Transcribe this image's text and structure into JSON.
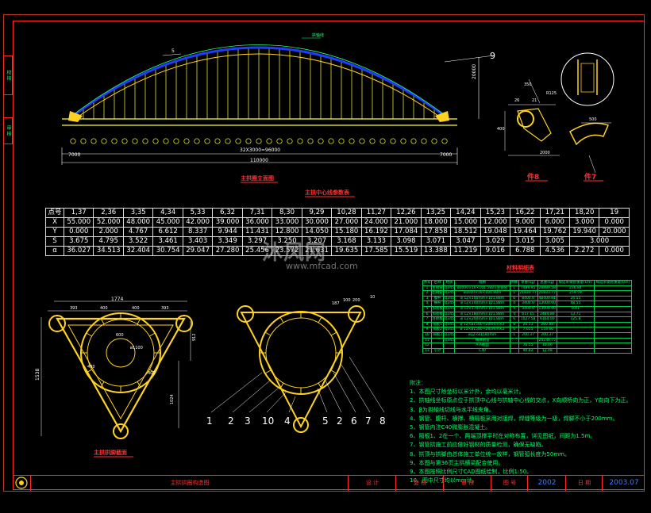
{
  "sidebar": {
    "tab1": "校 核",
    "tab2": "审 核"
  },
  "elevation": {
    "title": "主拱圈立面图",
    "arch_label": "拱轴线",
    "callout": "9",
    "dims": {
      "span": "110000",
      "segments": "32X3000=96000",
      "left": "7000",
      "right": "7000",
      "rise": "20000",
      "top": "5"
    }
  },
  "detail8": {
    "title": "件8",
    "dims": [
      "350",
      "8",
      "26",
      "8",
      "21",
      "150",
      "400",
      "R125",
      "480",
      "2000"
    ]
  },
  "detail7": {
    "title": "件7",
    "dims": [
      "500",
      "R100"
    ]
  },
  "param_table": {
    "title": "主拱中心线参数表",
    "rows": [
      {
        "h": "点号",
        "c": [
          "1,37",
          "2,36",
          "3,35",
          "4,34",
          "5,33",
          "6,32",
          "7,31",
          "8,30",
          "9,29",
          "10,28",
          "11,27",
          "12,26",
          "13,25",
          "14,24",
          "15,23",
          "16,22",
          "17,21",
          "18,20",
          "19"
        ]
      },
      {
        "h": "X",
        "c": [
          "55.000",
          "52.000",
          "48.000",
          "45.000",
          "42.000",
          "39.000",
          "36.000",
          "33.000",
          "30.000",
          "27.000",
          "24.000",
          "21.000",
          "18.000",
          "15.000",
          "12.000",
          "9.000",
          "6.000",
          "3.000",
          "0.000"
        ]
      },
      {
        "h": "Y",
        "c": [
          "0.000",
          "2.000",
          "4.767",
          "6.612",
          "8.337",
          "9.944",
          "11.431",
          "12.800",
          "14.050",
          "15.180",
          "16.192",
          "17.084",
          "17.858",
          "18.512",
          "19.048",
          "19.464",
          "19.762",
          "19.940",
          "20.000"
        ]
      },
      {
        "h": "S",
        "c": [
          "3.675",
          "4.795",
          "3.522",
          "3.461",
          "3.403",
          "3.349",
          "3.297",
          "3.250",
          "3.207",
          "3.168",
          "3.133",
          "3.098",
          "3.071",
          "3.047",
          "3.029",
          "3.015",
          "3.005",
          "3.000"
        ]
      },
      {
        "h": "α",
        "c": [
          "36.027",
          "34.513",
          "32.404",
          "30.754",
          "29.047",
          "27.280",
          "25.456",
          "23.572",
          "21.631",
          "19.635",
          "17.585",
          "15.519",
          "13.388",
          "11.219",
          "9.016",
          "6.788",
          "4.536",
          "2.272",
          "0.000"
        ]
      }
    ]
  },
  "section_a": {
    "title": "主拱拱脚截面",
    "dims": {
      "w": "1774",
      "a": "393",
      "b": "400",
      "c": "400",
      "d": "393",
      "h": "1538",
      "r1": "912",
      "r2": "1024",
      "d1": "600",
      "d2": "620",
      "rr": "ø1100",
      "s1": "400",
      "s2": "400"
    }
  },
  "section_b": {
    "dims": [
      "187",
      "100",
      "200",
      "50",
      "10"
    ],
    "callouts": [
      "1",
      "2",
      "3",
      "10",
      "4",
      "5",
      "2",
      "6",
      "7",
      "8"
    ]
  },
  "material": {
    "title": "材料明细表",
    "headers": [
      "件号",
      "名称",
      "材质",
      "规格",
      "件数",
      "单重(kg)",
      "总重(kg)",
      "每延米钢管重量(t/m)",
      "每延米钢管重量(t/m)"
    ],
    "rows": [
      [
        "1",
        "主钢管",
        "Q345",
        "ø1000×16×101.588×主钢管",
        "1",
        "7486.95",
        "28889.58"
      ],
      [
        "2",
        "副钢管",
        "Q345",
        "ø1100×16×101.88m",
        "1",
        "21833.77",
        "21833.77"
      ],
      [
        "3",
        "腹杆",
        "Q345",
        "ø 12×100mm×101.88m",
        "6",
        "8400.0",
        "48400.81"
      ],
      [
        "4",
        "横杆",
        "Q345",
        "ø 12×100mm×101.88m",
        "4",
        "3400.0",
        "13000.00"
      ],
      [
        "5",
        "加劲板",
        "Q345",
        "ø 12×174mm×101.88m",
        "4",
        "3400.0",
        "13000.00"
      ],
      [
        "6",
        "加劲板",
        "Q345",
        "ø 12×180mm×101.88m",
        "4",
        "617.15",
        "2484.86"
      ],
      [
        "7",
        "连接板",
        "Q345",
        "ø 12×200mm×101.88m",
        "6",
        "1027.58",
        "6164.00"
      ],
      [
        "8",
        "隔板1",
        "Q345",
        "ø 12×ø1580~280mm×2",
        "8",
        "25.11",
        "200.88"
      ],
      [
        "9",
        "隔板2",
        "Q345",
        "ø 12×ø1580~280mm×2",
        "6",
        "7.655",
        "153.60"
      ],
      [
        "10",
        "隔板3",
        "Q345",
        "ø12×ø1580mm",
        "1",
        "200.37",
        "200.37"
      ],
      [
        "11",
        "",
        "Q345",
        "横撑钢管",
        "",
        "",
        "24236.75"
      ],
      [
        "12",
        "",
        "",
        "A-A截面",
        "",
        "76.55",
        "10.06"
      ],
      [
        "13",
        "小计",
        "",
        "C40",
        "",
        "90.82",
        "12.48"
      ]
    ],
    "sums": [
      "236.84",
      "259.59",
      "24.55",
      "48.55",
      "0.01",
      "13.71",
      "125.8"
    ]
  },
  "notes": {
    "head": "附注：",
    "items": [
      "1、本图尺寸除坐标以米计外，余均以毫米计。",
      "2、拱轴线坐标原点位于拱顶中心线与拱轴中心线的交点，X向顺桥向为正，Y向向下为正。",
      "3、β为拱轴线切线与水平线夹角。",
      "4、钢管、腹杆、横撑、横隔板采用对接焊，焊缝等级为一级，焊脚不小于200mm。",
      "5、钢管内注C40微膨胀混凝土。",
      "6、隔板1、2在一个、两端顶撑平时在对称布置，详见图纸，间距为1.5m。",
      "7、钢管拱施工前应做好钢材的质量检测，确保无缺陷。",
      "8、拱顶与拱脚由总体施工单位统一放样，钢管弧长度为50mm。",
      "9、本图与第36页主拱横梁配合使用。",
      "9、本图按照比例尺寸CAD图纸绘制，比例1:50。",
      "10、图中尺寸均以mm计。"
    ]
  },
  "titleblock": {
    "drawing": "主拱拱圈构造图",
    "design": "设 计",
    "check": "复 核",
    "review": "审 核",
    "num_label": "图 号",
    "num": "2002",
    "date_label": "日 期",
    "date": "2003.07"
  },
  "watermark": {
    "brand": "沐风网",
    "url": "www.mfcad.com"
  },
  "colors": {
    "bg": "#000000",
    "frame": "#ff2a2a",
    "arch": "#1f3cff",
    "hanger": "#ffff33",
    "steel": "#ffd21f",
    "text_green": "#00ff66",
    "dim": "#ffffff",
    "accent_green": "#39ff8a"
  }
}
